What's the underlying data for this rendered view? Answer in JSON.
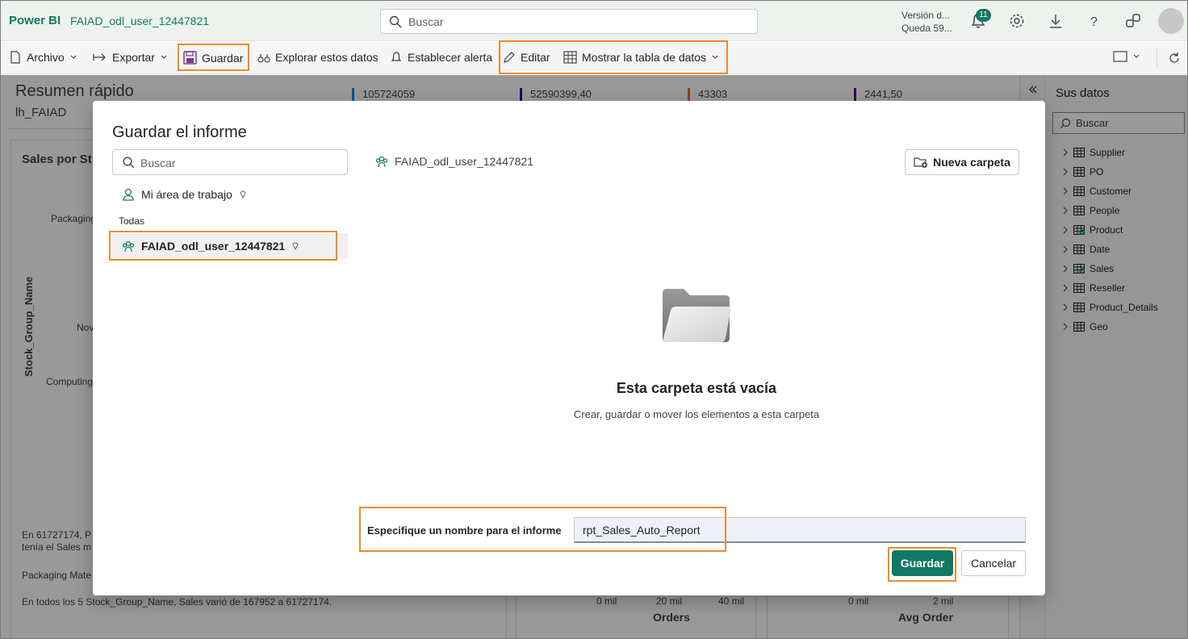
{
  "topbar": {
    "brand": "Power BI",
    "workspace": "FAIAD_odl_user_12447821",
    "search_placeholder": "Buscar",
    "trial_line1": "Versión d...",
    "trial_line2": "Queda 59...",
    "notification_count": "11"
  },
  "toolbar": {
    "archivo": "Archivo",
    "exportar": "Exportar",
    "guardar": "Guardar",
    "explorar": "Explorar estos datos",
    "alerta": "Establecer alerta",
    "editar": "Editar",
    "mostrar_tabla": "Mostrar la tabla de datos"
  },
  "report": {
    "title": "Resumen rápido",
    "subtitle": "lh_FAIAD",
    "kpis": [
      "105724059",
      "52590399,40",
      "43303",
      "2441,50"
    ],
    "card_title": "Sales por St",
    "axis_label": "Stock_Group_Name",
    "cat1": "Packaging",
    "cat2": "Nov",
    "cat3": "Computing",
    "text1a": "En 61727174, P",
    "text1b": "tenía el Sales m",
    "text2": "Packaging Mate",
    "text3": "En todos los 5 Stock_Group_Name, Sales varió de 167952 a 61727174.",
    "orders_ticks": [
      "0 mil",
      "20 mil",
      "40 mil"
    ],
    "orders_label": "Orders",
    "avg_ticks": [
      "0 mil",
      "2 mil"
    ],
    "avg_label": "Avg Order"
  },
  "data_pane": {
    "title": "Sus datos",
    "search_placeholder": "Buscar",
    "tables": [
      "Supplier",
      "PO",
      "Customer",
      "People",
      "Product",
      "Date",
      "Sales",
      "Reseller",
      "Product_Details",
      "Geo"
    ]
  },
  "dialog": {
    "title": "Guardar el informe",
    "search_placeholder": "Buscar",
    "my_workspace": "Mi área de trabajo",
    "section_all": "Todas",
    "workspace_item": "FAIAD_odl_user_12447821",
    "breadcrumb": "FAIAD_odl_user_12447821",
    "new_folder": "Nueva carpeta",
    "empty_title": "Esta carpeta está vacía",
    "empty_subtitle": "Crear, guardar o mover los elementos a esta carpeta",
    "name_label": "Especifique un nombre para el informe",
    "name_value": "rpt_Sales_Auto_Report",
    "save_button": "Guardar",
    "cancel_button": "Cancelar"
  },
  "colors": {
    "brand": "#117865",
    "highlight": "#ed8b2e"
  }
}
